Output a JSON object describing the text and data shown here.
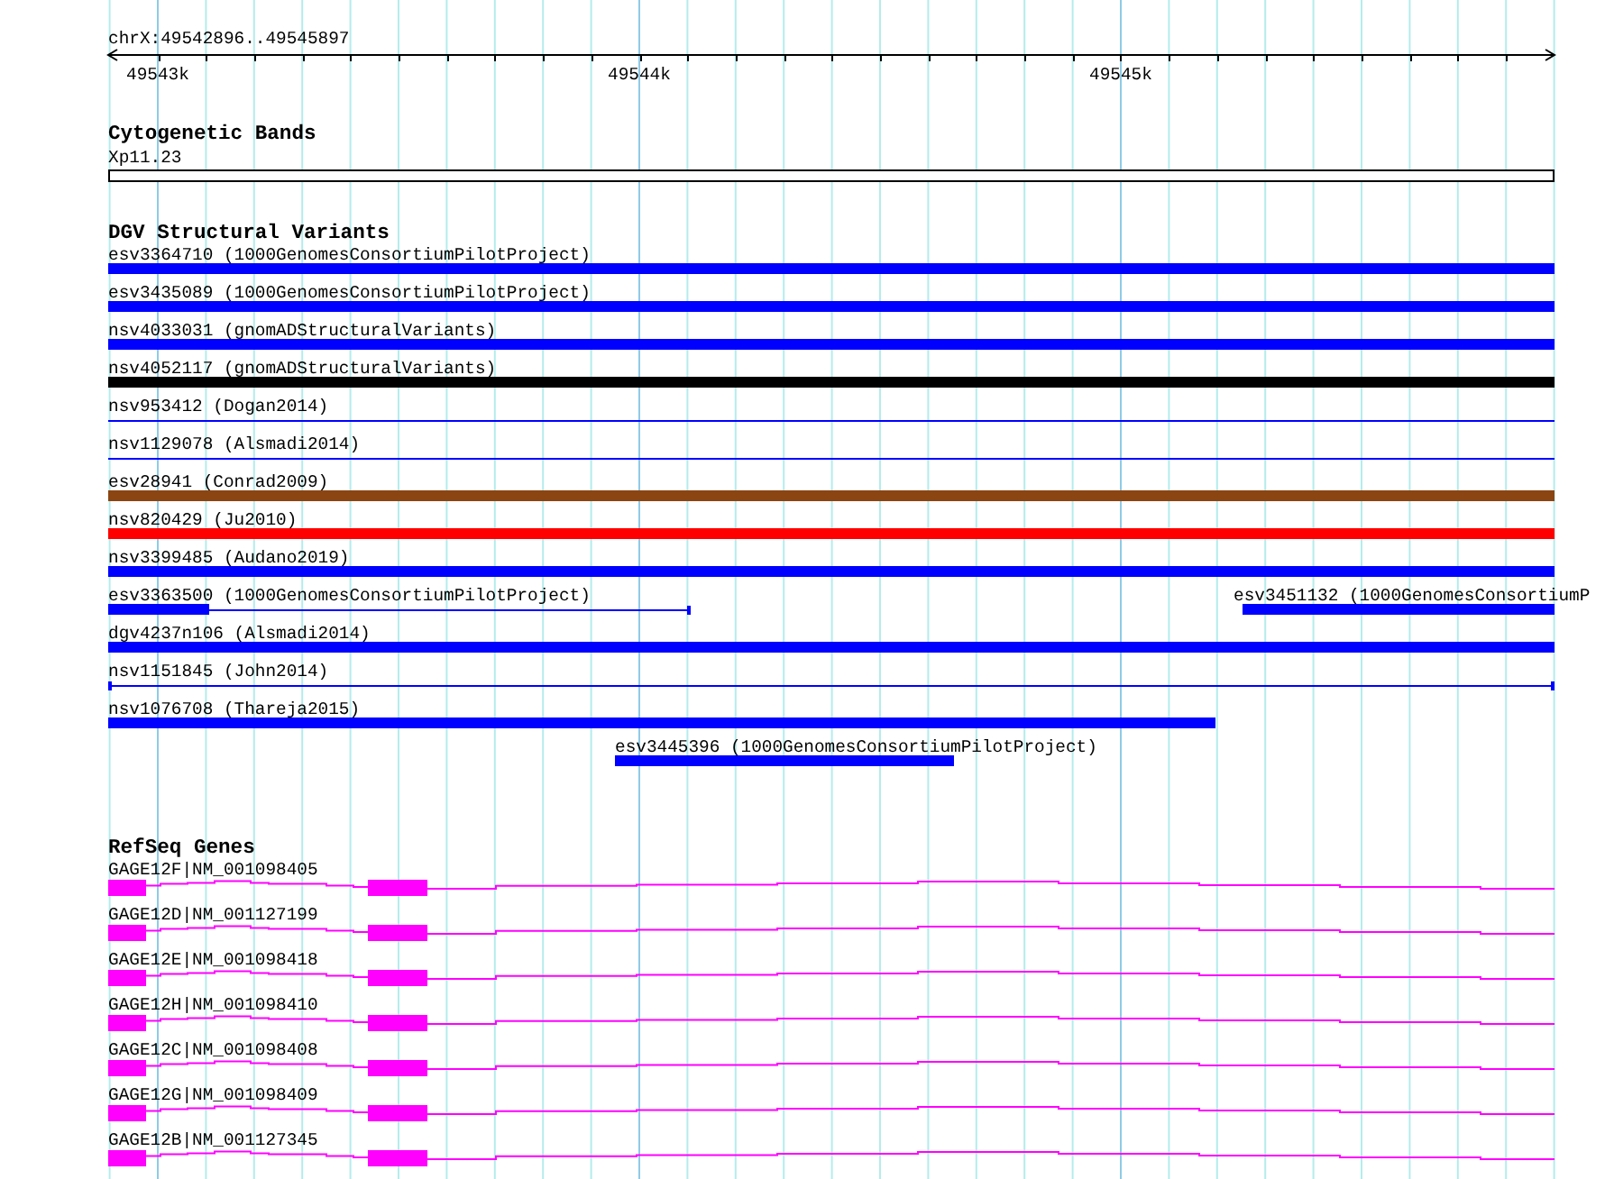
{
  "ruler": {
    "location": "chrX:49542896..49545897",
    "ticks": [
      "49543k",
      "49544k",
      "49545k"
    ]
  },
  "cytoband_track": {
    "title": "Cytogenetic Bands",
    "bands": [
      {
        "label": "Xp11.23"
      }
    ]
  },
  "dgv_track": {
    "title": "DGV Structural Variants",
    "features": [
      {
        "label": "esv3364710 (1000GenomesConsortiumPilotProject)",
        "kind": "bar",
        "color": "#0000ff"
      },
      {
        "label": "esv3435089 (1000GenomesConsortiumPilotProject)",
        "kind": "bar",
        "color": "#0000ff"
      },
      {
        "label": "nsv4033031 (gnomADStructuralVariants)",
        "kind": "bar",
        "color": "#0000ff"
      },
      {
        "label": "nsv4052117 (gnomADStructuralVariants)",
        "kind": "bar",
        "color": "#000000"
      },
      {
        "label": "nsv953412 (Dogan2014)",
        "kind": "line",
        "color": "#0000ff"
      },
      {
        "label": "nsv1129078 (Alsmadi2014)",
        "kind": "line",
        "color": "#0000ff"
      },
      {
        "label": "esv28941 (Conrad2009)",
        "kind": "bar",
        "color": "#8b4513"
      },
      {
        "label": "nsv820429 (Ju2010)",
        "kind": "bar",
        "color": "#ff0000"
      },
      {
        "label": "nsv3399485 (Audano2019)",
        "kind": "bar",
        "color": "#0000ff"
      },
      {
        "label": "esv3363500 (1000GenomesConsortiumPilotProject)",
        "kind": "gapped",
        "color": "#0000ff"
      },
      {
        "label": "esv3451132 (1000GenomesConsortiumP",
        "kind": "bar",
        "color": "#0000ff"
      },
      {
        "label": "dgv4237n106 (Alsmadi2014)",
        "kind": "bar",
        "color": "#0000ff"
      },
      {
        "label": "nsv1151845 (John2014)",
        "kind": "capped_line",
        "color": "#0000ff"
      },
      {
        "label": "nsv1076708 (Thareja2015)",
        "kind": "bar",
        "color": "#0000ff"
      },
      {
        "label": "esv3445396 (1000GenomesConsortiumPilotProject)",
        "kind": "bar",
        "color": "#0000ff"
      }
    ]
  },
  "refseq_track": {
    "title": "RefSeq Genes",
    "genes": [
      {
        "label": "GAGE12F|NM_001098405"
      },
      {
        "label": "GAGE12D|NM_001127199"
      },
      {
        "label": "GAGE12E|NM_001098418"
      },
      {
        "label": "GAGE12H|NM_001098410"
      },
      {
        "label": "GAGE12C|NM_001098408"
      },
      {
        "label": "GAGE12G|NM_001098409"
      },
      {
        "label": "GAGE12B|NM_001127345"
      }
    ]
  }
}
